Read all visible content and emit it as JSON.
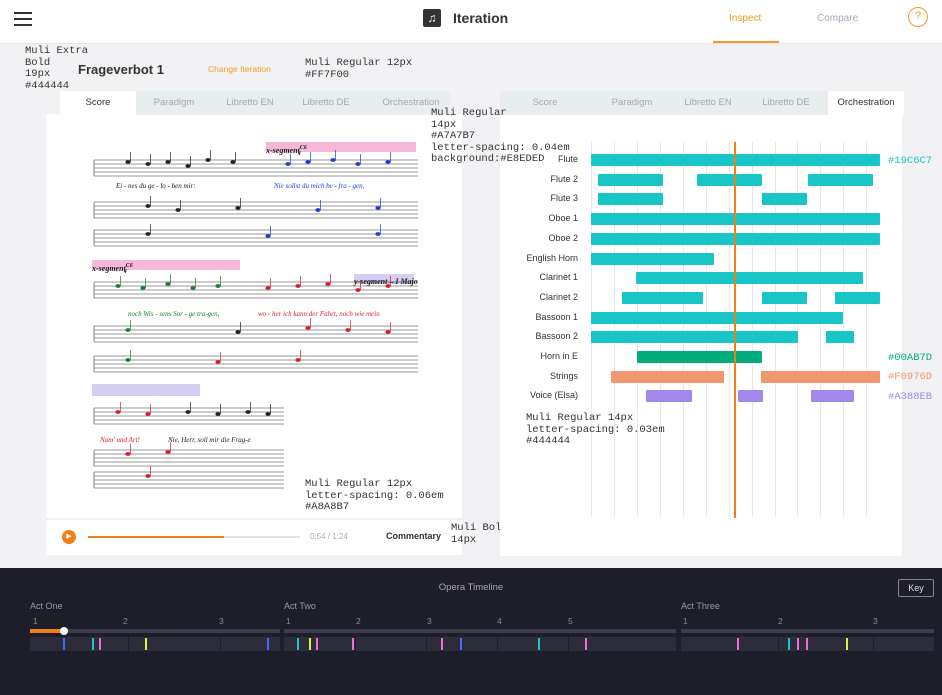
{
  "app": {
    "title": "Iteration",
    "nav_inspect": "Inspect",
    "nav_compare": "Compare",
    "help": "?"
  },
  "header": {
    "piece_title": "Frageverbot 1",
    "change_label": "Change Iteration"
  },
  "annotations": {
    "a1": "Muli Extra\nBold\n19px\n#444444",
    "a2": "Muli Regular 12px\n#FF7F00",
    "a3": "Muli Regular\n14px\n#A7A7B7\nletter-spacing: 0.04em\nbackground:#E8EDED",
    "a4": "Muli Regular 12px\nletter-spacing: 0.06em\n#A8A8B7",
    "a5": "Muli Bold\n14px",
    "a6": "Muli Regular 14px\nletter-spacing: 0.03em\n#444444",
    "c1": "#19C6C7",
    "c2": "#00AB7D",
    "c3": "#F0976D",
    "c4": "#A388EB"
  },
  "left_tabs": [
    "Score",
    "Paradigm",
    "Libretto EN",
    "Libretto DE",
    "Orchestration"
  ],
  "right_tabs": [
    "Score",
    "Paradigm",
    "Libretto EN",
    "Libretto DE",
    "Orchestration"
  ],
  "score": {
    "seg1": "x-segment",
    "seg1_sup": "C6",
    "seg1_sub": "4",
    "seg2": "x-segment",
    "seg2_sup": "C6",
    "seg2_sub": "4",
    "seg3": "y-segment→I Majo",
    "lyric1a": "Ei - nes  du  ge - lo - ben  mir:",
    "lyric1b": "Nie   sollst  du  mich   be - fra - gen,",
    "lyric2a": "noch  Wis - sens  Sor - ge   tra-gen,",
    "lyric2b": "wo  -  her  ich  kann  der   Fahrt,  noch  wie  mein",
    "lyric3a": "Nam'  und   Art!",
    "lyric3b": "Nie,  Herr,  soll  mir  die  Frag-e"
  },
  "player": {
    "time": "0:54 / 1:24",
    "commentary": "Commentary",
    "progress": 0.64
  },
  "orchestration": {
    "rows": [
      "Flute",
      "Flute 2",
      "Flute 3",
      "Oboe 1",
      "Oboe 2",
      "English Horn",
      "Clarinet 1",
      "Clarinet 2",
      "Bassoon 1",
      "Bassoon 2",
      "Horn in E",
      "Strings",
      "Voice (Elsa)"
    ],
    "colors": {
      "winds": "#19C6C7",
      "horn": "#00AB7D",
      "strings": "#F0976D",
      "voice": "#A388EB",
      "playhead": "#F07F1A"
    }
  },
  "timeline": {
    "title": "Opera Timeline",
    "key": "Key",
    "acts": [
      {
        "name": "Act One",
        "nums": [
          "1",
          "2",
          "3"
        ]
      },
      {
        "name": "Act Two",
        "nums": [
          "1",
          "2",
          "3",
          "4",
          "5"
        ]
      },
      {
        "name": "Act Three",
        "nums": [
          "1",
          "2",
          "3"
        ]
      }
    ]
  }
}
